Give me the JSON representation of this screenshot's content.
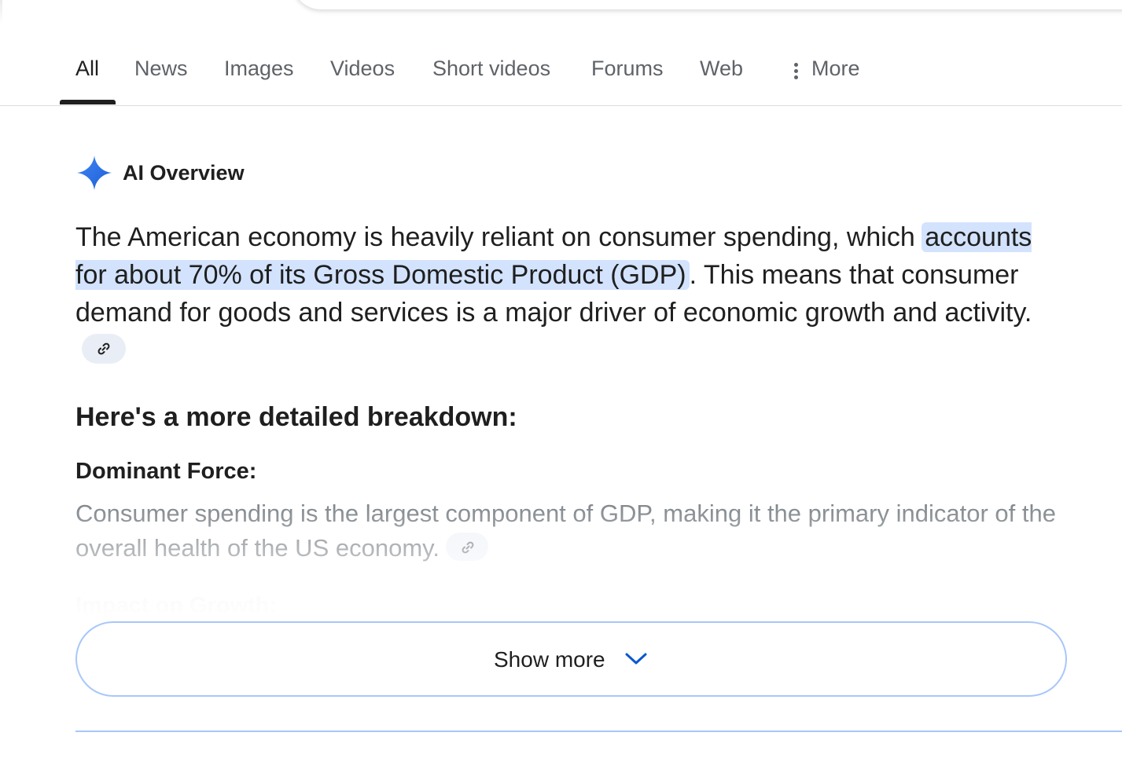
{
  "tabs": [
    {
      "label": "All",
      "active": true
    },
    {
      "label": "News"
    },
    {
      "label": "Images"
    },
    {
      "label": "Videos"
    },
    {
      "label": "Short videos"
    },
    {
      "label": "Forums"
    },
    {
      "label": "Web"
    },
    {
      "label": "More",
      "icon": "more-vert-icon"
    }
  ],
  "ai_overview": {
    "icon": "sparkle-icon",
    "title": "AI Overview",
    "paragraph": {
      "lead": "The American economy is heavily reliant on consumer spending, which ",
      "highlight": "accounts for about 70% of its Gross Domestic Product (GDP)",
      "tail": ". This means that consumer demand for goods and services is a major driver of economic growth and activity."
    },
    "subheading": "Here's a more detailed breakdown:",
    "items": [
      {
        "title": "Dominant Force:",
        "description": "Consumer spending is the largest component of GDP, making it the primary indicator of the overall health of the US economy."
      },
      {
        "title": "Impact on Growth:"
      }
    ],
    "show_more_label": "Show more"
  },
  "colors": {
    "accent": "#0b57d0",
    "highlight": "#d3e3fd",
    "border": "#a8c7fa"
  }
}
